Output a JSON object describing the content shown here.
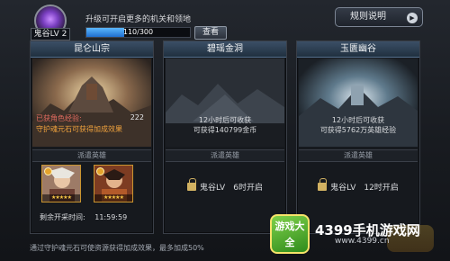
{
  "header": {
    "level_label": "鬼谷LV 2",
    "upgrade_hint": "升级可开启更多的机关和领地",
    "xp_current": 110,
    "xp_max": 300,
    "xp_text": "110/300",
    "check_button": "查看",
    "rules_button": "规则说明"
  },
  "cards": [
    {
      "title": "昆仑山宗",
      "info_lines": [
        "已获角色经验:",
        "守护魂元石可获得加成效果"
      ],
      "exp_value": "222",
      "dispatch_label": "派遣英雄",
      "hero_stars": [
        "★★★★★",
        "★★★★★"
      ],
      "remaining_label": "剩余开采时间:",
      "remaining_time": "11:59:59"
    },
    {
      "title": "碧瑶金洞",
      "info_lines": [
        "12小时后可收获",
        "可获得140799金币"
      ],
      "dispatch_label": "派遣英雄",
      "lock_text": "鬼谷LV　6时开启"
    },
    {
      "title": "玉匮幽谷",
      "info_lines": [
        "12小时后可收获",
        "可获得5762万英雄经验"
      ],
      "dispatch_label": "派遣英雄",
      "lock_text": "鬼谷LV　12时开启"
    }
  ],
  "footer": "通过守护魂元石可使资源获得加成效果，最多加成50%",
  "watermark": {
    "logo": "游戏大全",
    "name": "4399手机游戏网",
    "url": "www.4399.cn"
  },
  "colors": {
    "title_bar": "#2d4257",
    "accent_red": "#e05a4a",
    "accent_orange": "#f2a23a",
    "xp_fill": "#3a8ee8"
  }
}
